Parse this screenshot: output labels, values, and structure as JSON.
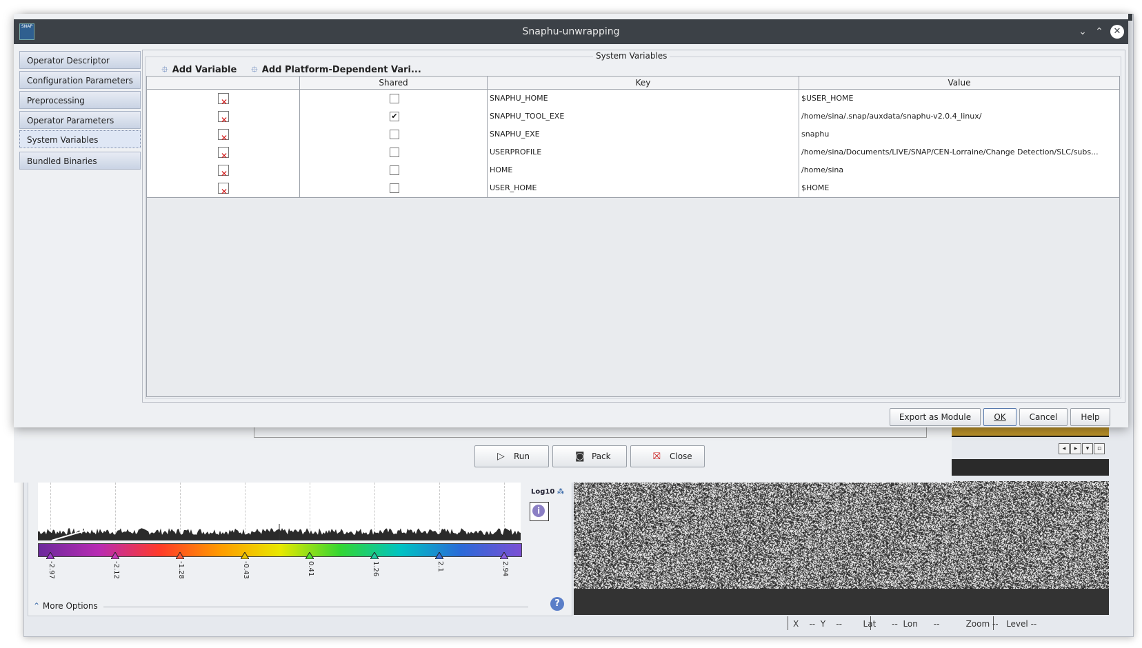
{
  "dialog": {
    "title": "Snaphu-unwrapping",
    "app_icon_text": "SNAP",
    "content_title": "System Variables",
    "add_variable_label": "Add Variable",
    "add_platform_variable_label": "Add Platform-Dependent Vari...",
    "export_label": "Export as Module",
    "ok_label": "OK",
    "cancel_label": "Cancel",
    "help_label": "Help"
  },
  "sidebar": {
    "items": [
      {
        "label": "Operator Descriptor"
      },
      {
        "label": "Configuration Parameters"
      },
      {
        "label": "Preprocessing"
      },
      {
        "label": "Operator Parameters"
      },
      {
        "label": "System Variables",
        "active": true
      },
      {
        "label": "Bundled Binaries"
      }
    ]
  },
  "table": {
    "headers": [
      "",
      "Shared",
      "Key",
      "Value"
    ],
    "rows": [
      {
        "shared": false,
        "key": "SNAPHU_HOME",
        "value": "$USER_HOME"
      },
      {
        "shared": true,
        "key": "SNAPHU_TOOL_EXE",
        "value": "/home/sina/.snap/auxdata/snaphu-v2.0.4_linux/"
      },
      {
        "shared": false,
        "key": "SNAPHU_EXE",
        "value": "snaphu"
      },
      {
        "shared": false,
        "key": "USERPROFILE",
        "value": "/home/sina/Documents/LIVE/SNAP/CEN-Lorraine/Change Detection/SLC/subs..."
      },
      {
        "shared": false,
        "key": "HOME",
        "value": "/home/sina"
      },
      {
        "shared": false,
        "key": "USER_HOME",
        "value": "$HOME"
      }
    ]
  },
  "inner_buttons": {
    "run_label": "Run",
    "pack_label": "Pack",
    "close_label": "Close"
  },
  "colorbar": {
    "log_label": "Log10",
    "ticks": [
      "-2.97",
      "-2.12",
      "-1.28",
      "-0.43",
      "0.41",
      "1.26",
      "2.1",
      "2.94"
    ],
    "tick_colors": [
      "#9a3cc7",
      "#c43bb8",
      "#ff5a3a",
      "#e6c200",
      "#55dd33",
      "#22c7a0",
      "#3a6fd8",
      "#8a5fe0"
    ],
    "more_options_label": "More Options"
  },
  "status_bar": {
    "text": "X    --  Y    --        Lat      --  Lon      --          Zoom --   Level --"
  },
  "colors": {
    "titlebar": "#3c4147",
    "sidebar_item": "#c9d3e4",
    "delete_icon": "#d01010"
  }
}
